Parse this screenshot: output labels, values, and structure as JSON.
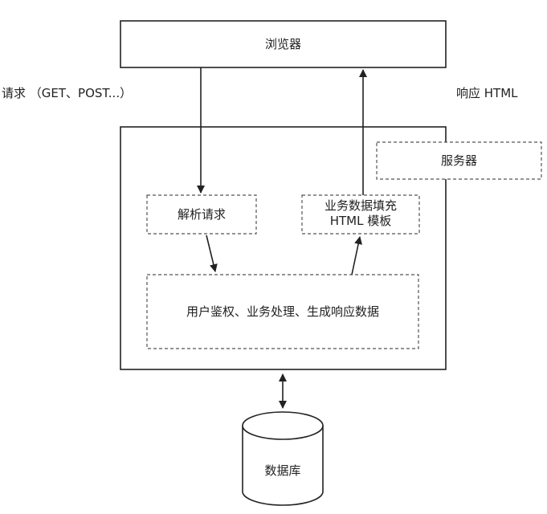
{
  "browser": {
    "label": "浏览器"
  },
  "request_label": "请求 （GET、POST...）",
  "response_label": "响应 HTML",
  "server": {
    "label": "服务器"
  },
  "parse_request": {
    "label": "解析请求"
  },
  "template_fill": {
    "line1": "业务数据填充",
    "line2": "HTML 模板"
  },
  "processing": {
    "label": "用户鉴权、业务处理、生成响应数据"
  },
  "database": {
    "label": "数据库"
  },
  "colors": {
    "stroke": "#222222",
    "dashed": "#555555",
    "background": "#ffffff"
  }
}
